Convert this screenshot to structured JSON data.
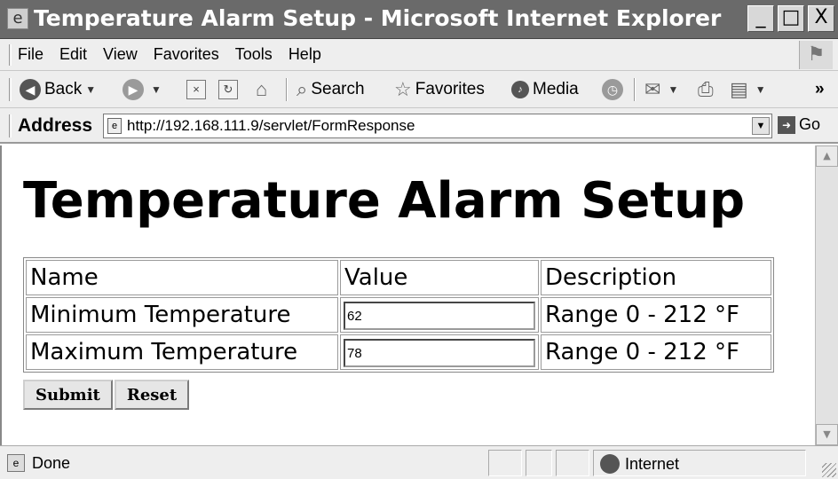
{
  "window": {
    "title": "Temperature Alarm Setup - Microsoft Internet Explorer",
    "minimize": "_",
    "maximize": "□",
    "close": "X"
  },
  "menu": {
    "items": [
      "File",
      "Edit",
      "View",
      "Favorites",
      "Tools",
      "Help"
    ]
  },
  "toolbar": {
    "back": "Back",
    "search": "Search",
    "favorites": "Favorites",
    "media": "Media",
    "more": "»"
  },
  "address": {
    "label": "Address",
    "url": "http://192.168.111.9/servlet/FormResponse",
    "go": "Go"
  },
  "page": {
    "heading": "Temperature Alarm Setup",
    "table": {
      "headers": [
        "Name",
        "Value",
        "Description"
      ],
      "rows": [
        {
          "name": "Minimum Temperature",
          "value": "62",
          "description": "Range 0 - 212 °F"
        },
        {
          "name": "Maximum Temperature",
          "value": "78",
          "description": "Range 0 - 212 °F"
        }
      ]
    },
    "buttons": {
      "submit": "Submit",
      "reset": "Reset"
    }
  },
  "status": {
    "text": "Done",
    "zone": "Internet"
  }
}
